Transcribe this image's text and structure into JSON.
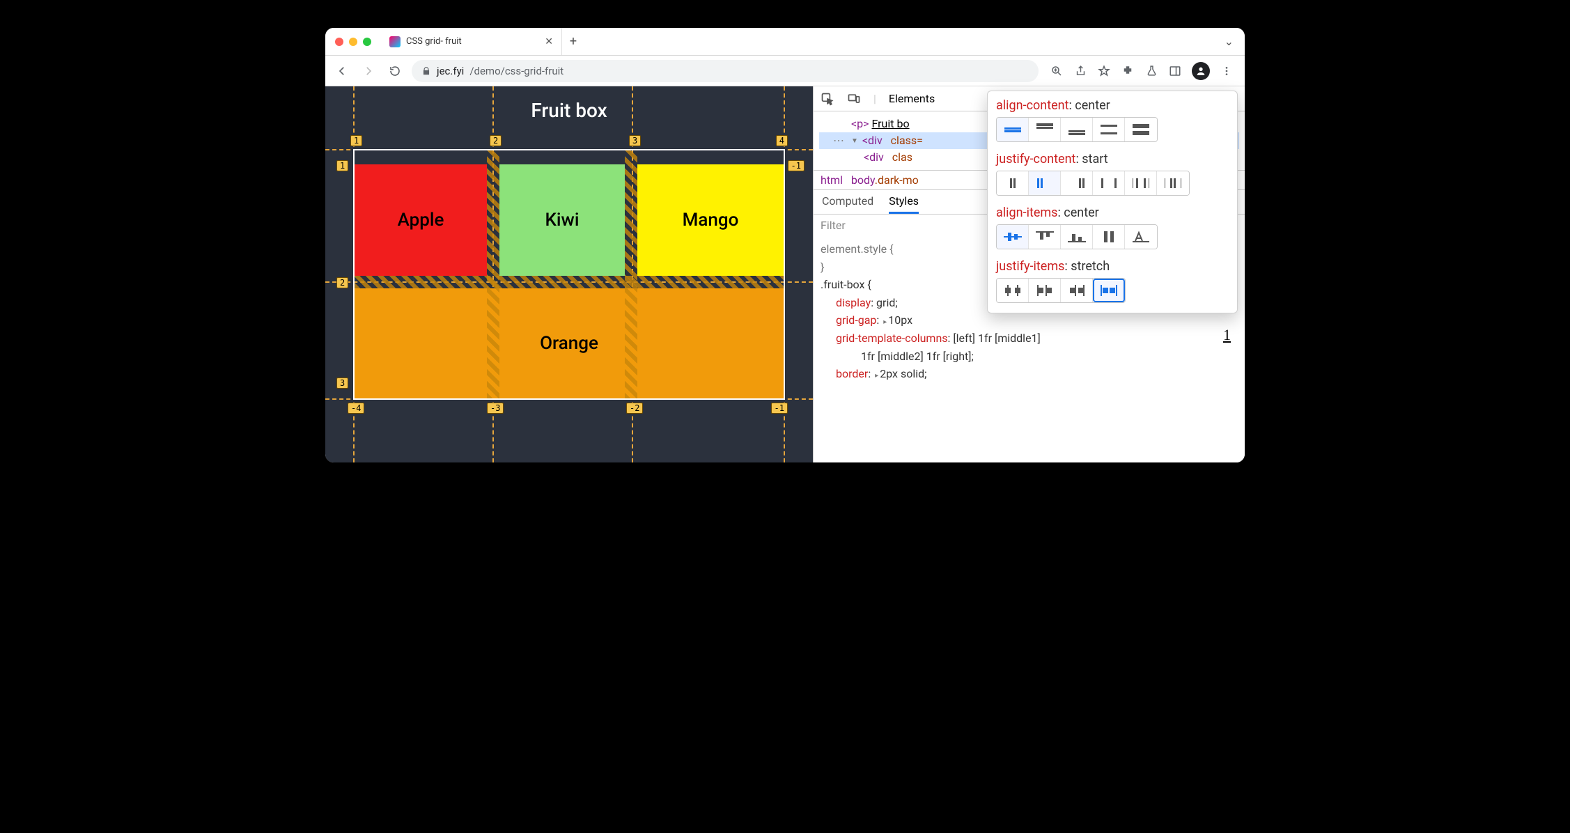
{
  "tab": {
    "title": "CSS grid- fruit"
  },
  "url": {
    "host": "jec.fyi",
    "path": "/demo/css-grid-fruit"
  },
  "page": {
    "heading": "Fruit box",
    "cells": {
      "apple": "Apple",
      "kiwi": "Kiwi",
      "mango": "Mango",
      "orange": "Orange"
    },
    "col_lines_top": [
      "1",
      "2",
      "3",
      "4"
    ],
    "col_lines_bottom": [
      "-4",
      "-3",
      "-2",
      "-1"
    ],
    "row_lines_left": [
      "1",
      "2"
    ],
    "row_lines_right": [
      "-1"
    ]
  },
  "devtools": {
    "main_tab": "Elements",
    "dom": {
      "p_text": "Fruit bo",
      "div_open": "<div class=",
      "div_child": "<div clas"
    },
    "crumbs": {
      "root": "html",
      "body": "body",
      "body_cls": ".dark-mo"
    },
    "subtabs": {
      "computed": "Computed",
      "styles": "Styles"
    },
    "filter_placeholder": "Filter",
    "styles_block": {
      "element_style": "element.style {",
      "close": "}",
      "rule_sel": ".fruit-box {",
      "display": {
        "p": "display",
        "v": "grid;"
      },
      "gap": {
        "p": "grid-gap",
        "v": "10px"
      },
      "gtc": {
        "p": "grid-template-columns",
        "v": "[left] 1fr [middle1]"
      },
      "gtc2": "1fr [middle2] 1fr [right];",
      "border": {
        "p": "border",
        "v": "2px solid;"
      }
    },
    "link_line": "1"
  },
  "popover": {
    "rows": [
      {
        "prop": "align-content",
        "val": "center",
        "selected": 0,
        "count": 5
      },
      {
        "prop": "justify-content",
        "val": "start",
        "selected": 1,
        "count": 6
      },
      {
        "prop": "align-items",
        "val": "center",
        "selected": 0,
        "count": 5
      },
      {
        "prop": "justify-items",
        "val": "stretch",
        "selected": 3,
        "count": 4,
        "outlined": 3
      }
    ]
  }
}
